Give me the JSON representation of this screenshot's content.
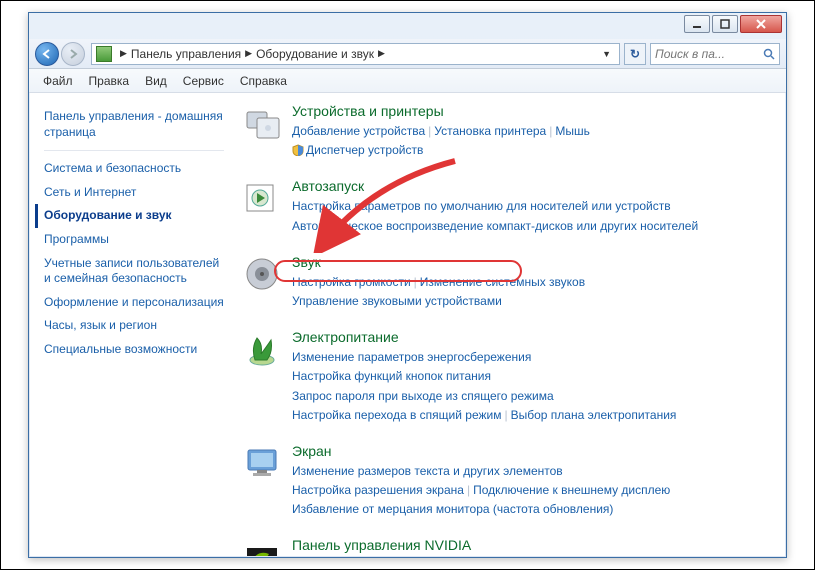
{
  "breadcrumb": {
    "root": "Панель управления",
    "current": "Оборудование и звук"
  },
  "search_placeholder": "Поиск в па...",
  "menu": [
    "Файл",
    "Правка",
    "Вид",
    "Сервис",
    "Справка"
  ],
  "sidebar": {
    "home": "Панель управления - домашняя страница",
    "items": [
      "Система и безопасность",
      "Сеть и Интернет",
      "Оборудование и звук",
      "Программы",
      "Учетные записи пользователей и семейная безопасность",
      "Оформление и персонализация",
      "Часы, язык и регион",
      "Специальные возможности"
    ],
    "active": 2
  },
  "categories": [
    {
      "id": "devices",
      "title": "Устройства и принтеры",
      "links": [
        {
          "t": "Добавление устройства"
        },
        {
          "t": "Установка принтера"
        },
        {
          "t": "Мышь"
        },
        {
          "t": "Диспетчер устройств",
          "shield": true,
          "br": true
        }
      ]
    },
    {
      "id": "autoplay",
      "title": "Автозапуск",
      "links": [
        {
          "t": "Настройка параметров по умолчанию для носителей или устройств"
        },
        {
          "t": "Автоматическое воспроизведение компакт-дисков или других носителей",
          "br": true
        }
      ]
    },
    {
      "id": "sound",
      "title": "Звук",
      "links": [
        {
          "t": "Настройка громкости"
        },
        {
          "t": "Изменение системных звуков"
        },
        {
          "t": "Управление звуковыми устройствами",
          "br": true,
          "hl": true
        }
      ]
    },
    {
      "id": "power",
      "title": "Электропитание",
      "links": [
        {
          "t": "Изменение параметров энергосбережения"
        },
        {
          "t": "Настройка функций кнопок питания",
          "br": true
        },
        {
          "t": "Запрос пароля при выходе из спящего режима",
          "br": true
        },
        {
          "t": "Настройка перехода в спящий режим",
          "br": true
        },
        {
          "t": "Выбор плана электропитания"
        }
      ]
    },
    {
      "id": "display",
      "title": "Экран",
      "links": [
        {
          "t": "Изменение размеров текста и других элементов"
        },
        {
          "t": "Настройка разрешения экрана",
          "br": true
        },
        {
          "t": "Подключение к внешнему дисплею"
        },
        {
          "t": "Избавление от мерцания монитора (частота обновления)",
          "br": true
        }
      ]
    },
    {
      "id": "nvidia",
      "title": "Панель управления NVIDIA",
      "links": []
    }
  ]
}
